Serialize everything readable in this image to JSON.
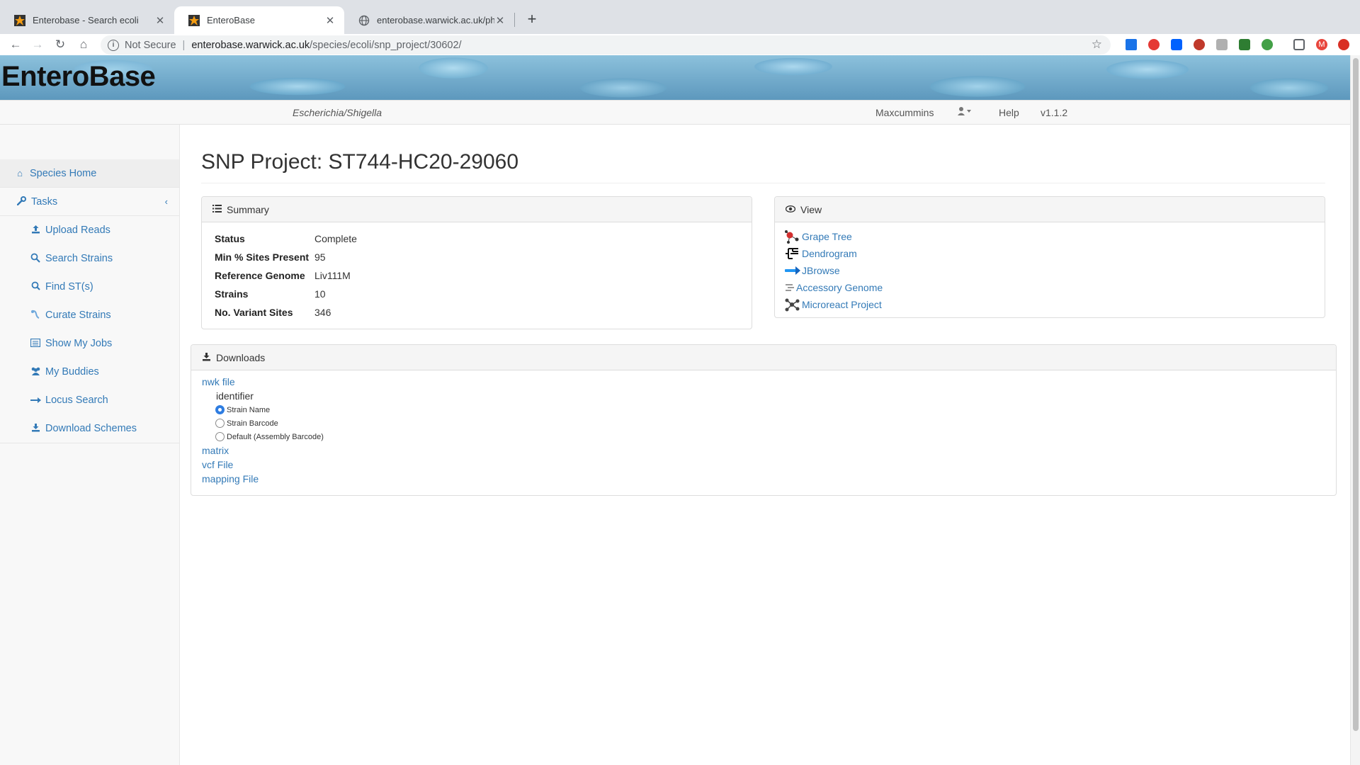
{
  "browser": {
    "tabs": [
      {
        "title": "Enterobase - Search ecoli",
        "active": false
      },
      {
        "title": "EnteroBase",
        "active": true
      },
      {
        "title": "enterobase.warwick.ac.uk/phylo",
        "active": false
      }
    ],
    "address": {
      "security": "Not Secure",
      "host": "enterobase.warwick.ac.uk",
      "path": "/species/ecoli/snp_project/30602/"
    },
    "profile_initial": "M"
  },
  "site": {
    "brand": "EnteroBase",
    "species": "Escherichia/Shigella",
    "user": "Maxcummins",
    "help": "Help",
    "version": "v1.1.2"
  },
  "sidebar": {
    "home": "Species Home",
    "tasks": "Tasks",
    "items": [
      {
        "label": "Upload Reads",
        "icon": "upload-icon"
      },
      {
        "label": "Search Strains",
        "icon": "search-strains-icon"
      },
      {
        "label": "Find ST(s)",
        "icon": "search-icon"
      },
      {
        "label": "Curate Strains",
        "icon": "curate-icon"
      },
      {
        "label": "Show My Jobs",
        "icon": "list-icon"
      },
      {
        "label": "My Buddies",
        "icon": "users-icon"
      },
      {
        "label": "Locus Search",
        "icon": "arrow-icon"
      },
      {
        "label": "Download Schemes",
        "icon": "download-icon"
      }
    ]
  },
  "main": {
    "title": "SNP Project: ST744-HC20-29060",
    "summary": {
      "heading": "Summary",
      "rows": [
        {
          "key": "Status",
          "value": "Complete"
        },
        {
          "key": "Min % Sites Present",
          "value": "95"
        },
        {
          "key": "Reference Genome",
          "value": "Liv111M"
        },
        {
          "key": "Strains",
          "value": "10"
        },
        {
          "key": "No. Variant Sites",
          "value": "346"
        }
      ]
    },
    "view": {
      "heading": "View",
      "items": [
        "Grape Tree",
        "Dendrogram",
        "JBrowse",
        "Accessory Genome",
        "Microreact Project"
      ]
    },
    "downloads": {
      "heading": "Downloads",
      "nwk": "nwk file",
      "identifier_label": "identifier",
      "options": [
        "Strain Name",
        "Strain Barcode",
        "Default (Assembly Barcode)"
      ],
      "selected_option": "Strain Name",
      "matrix": "matrix",
      "vcf": "vcf File",
      "mapping": "mapping File"
    }
  }
}
